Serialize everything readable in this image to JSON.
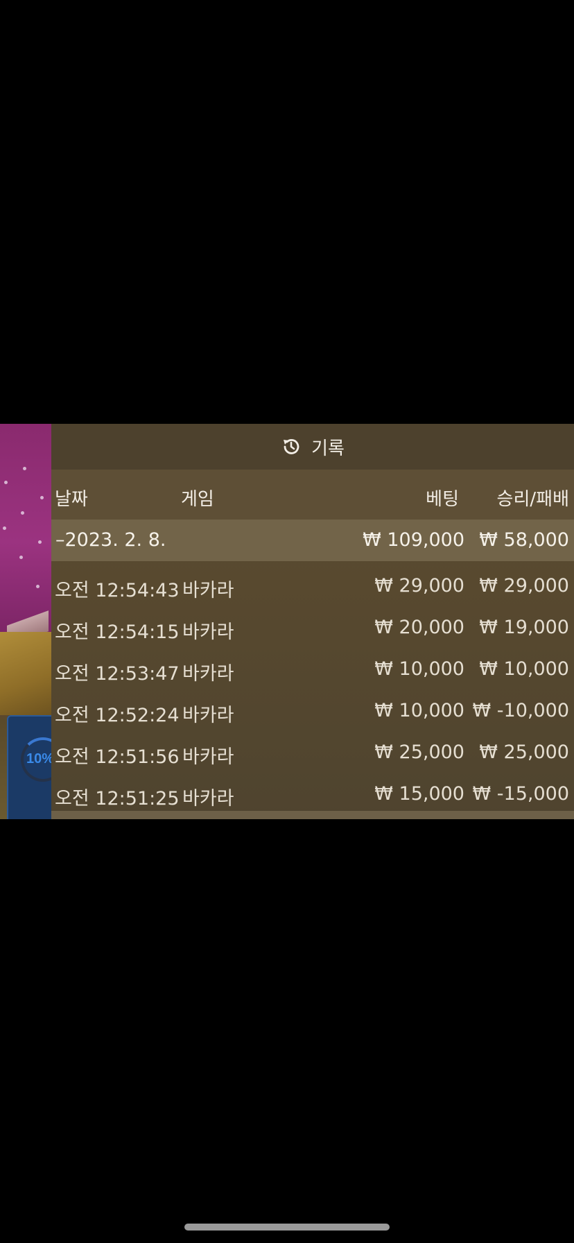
{
  "overlay": {
    "progress_label": "10%"
  },
  "history": {
    "title": "기록",
    "icon": "history-clock-icon",
    "columns": {
      "date": "날짜",
      "game": "게임",
      "bet": "베팅",
      "win_loss": "승리/패배"
    },
    "date_group": {
      "label": "–2023. 2. 8.",
      "bet_total": "₩ 109,000",
      "win_loss_total": "₩ 58,000"
    },
    "rows": [
      {
        "time": "오전 12:54:43",
        "game": "바카라",
        "bet": "₩ 29,000",
        "win_loss": "₩ 29,000"
      },
      {
        "time": "오전 12:54:15",
        "game": "바카라",
        "bet": "₩ 20,000",
        "win_loss": "₩ 19,000"
      },
      {
        "time": "오전 12:53:47",
        "game": "바카라",
        "bet": "₩ 10,000",
        "win_loss": "₩ 10,000"
      },
      {
        "time": "오전 12:52:24",
        "game": "바카라",
        "bet": "₩ 10,000",
        "win_loss": "₩ -10,000"
      },
      {
        "time": "오전 12:51:56",
        "game": "바카라",
        "bet": "₩ 25,000",
        "win_loss": "₩ 25,000"
      },
      {
        "time": "오전 12:51:25",
        "game": "바카라",
        "bet": "₩ 15,000",
        "win_loss": "₩ -15,000"
      }
    ]
  }
}
